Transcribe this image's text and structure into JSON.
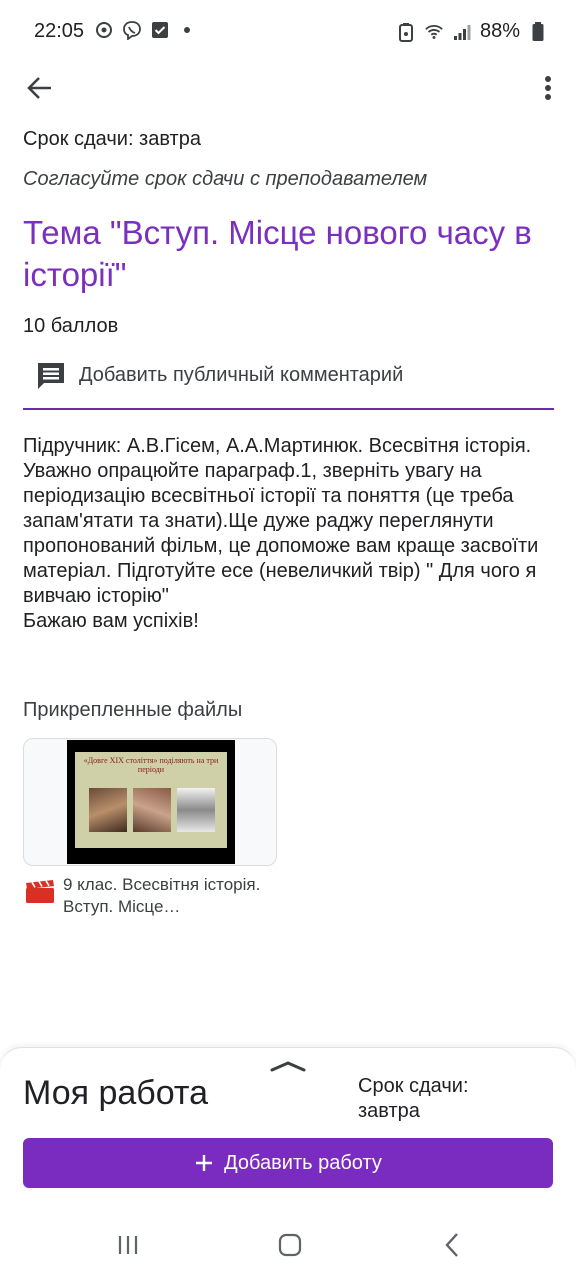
{
  "status_bar": {
    "time": "22:05",
    "battery": "88%",
    "icons_left": [
      "sync-icon",
      "viber-icon",
      "check-box-icon",
      "dot-icon"
    ],
    "icons_right": [
      "alarm-icon",
      "wifi-icon",
      "signal-icon",
      "battery-icon"
    ]
  },
  "app_bar": {
    "back_icon": "back-arrow-icon",
    "more_icon": "more-vert-icon"
  },
  "assignment": {
    "due_text": "Срок сдачи: завтра",
    "note": "Согласуйте срок сдачи с преподавателем",
    "title": "Тема \"Вступ. Місце нового часу в історії\"",
    "points": "10 баллов",
    "comment_label": "Добавить публичный комментарий",
    "description": "Підручник: А.В.Гісем, А.А.Мартинюк. Всесвітня історія. Уважно опрацюйте параграф.1, зверніть увагу на періодизацію всесвітньої історії та поняття (це треба запам'ятати та знати).Ще дуже раджу переглянути пропонований фільм, це допоможе вам краще засвоїти матеріал. Підготуйте есе (невеличкий твір) \" Для чого я вивчаю історію\"\nБажаю вам успіхів!"
  },
  "attachments": {
    "header": "Прикрепленные файлы",
    "items": [
      {
        "name": "9 клас. Всесвітня історія. Вступ.  Місце…",
        "thumb_title": "«Довге ХІХ століття» поділяють на три періоди",
        "icon": "video-clapper-icon"
      }
    ]
  },
  "my_work": {
    "title": "Моя работа",
    "due": "Срок сдачи: завтра",
    "add_button": "Добавить работу"
  },
  "colors": {
    "accent": "#7b2fbe",
    "button": "#7a2cc0",
    "divider": "#6a2fa6",
    "file_icon": "#d93025"
  }
}
